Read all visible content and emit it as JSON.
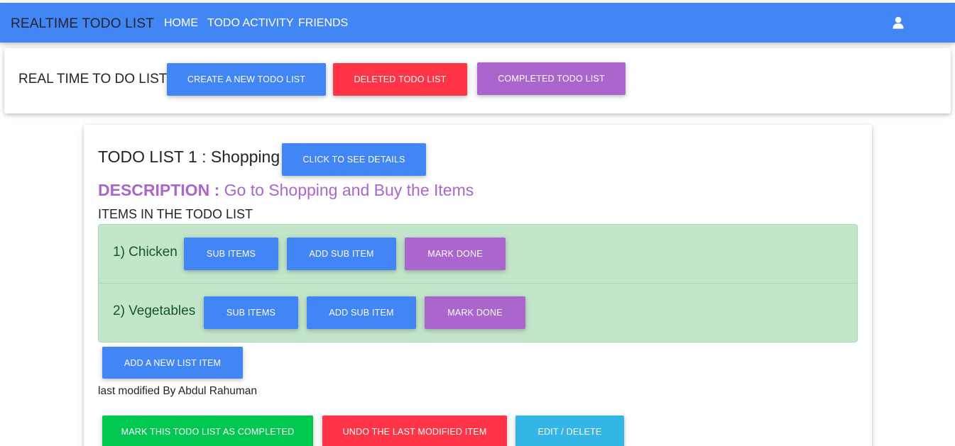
{
  "nav": {
    "brand": "REALTIME TODO LIST",
    "links": [
      "HOME",
      "TODO ACTIVITY",
      "FRIENDS"
    ],
    "user_icon": "user-icon"
  },
  "header": {
    "title": "REAL TIME TO DO LIST",
    "create_label": "CREATE A NEW TODO LIST",
    "deleted_label": "DELETED TODO LIST",
    "completed_label": "COMPLETED TODO LIST"
  },
  "todo": {
    "title": "TODO LIST 1 : Shopping",
    "details_label": "CLICK TO SEE DETAILS",
    "description_label": "DESCRIPTION :",
    "description_text": "Go to Shopping and Buy the Items",
    "items_heading": "ITEMS IN THE TODO LIST",
    "items": [
      {
        "label": "1) Chicken",
        "sub_items": "SUB ITEMS",
        "add_sub": "ADD SUB ITEM",
        "mark_done": "MARK DONE"
      },
      {
        "label": "2) Vegetables",
        "sub_items": "SUB ITEMS",
        "add_sub": "ADD SUB ITEM",
        "mark_done": "MARK DONE"
      }
    ],
    "add_item_label": "ADD A NEW LIST ITEM",
    "last_modified": "last modified By Abdul Rahuman",
    "complete_label": "MARK THIS TODO LIST AS COMPLETED",
    "undo_label": "UNDO THE LAST MODIFIED ITEM",
    "edit_label": "EDIT / DELETE"
  },
  "colors": {
    "primary": "#4285f4",
    "danger": "#ff3547",
    "secondary": "#aa66cc",
    "success": "#00c851",
    "info": "#33b5e5",
    "list_bg": "#c3e6cb"
  }
}
